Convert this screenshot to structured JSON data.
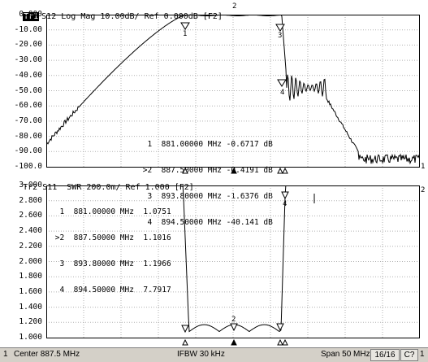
{
  "trace1": {
    "badge": "Tr1",
    "header": "S12 Log Mag 10.00dB/ Ref 0.000dB [F2]",
    "y_labels": [
      "0.000",
      "-10.00",
      "-20.00",
      "-30.00",
      "-40.00",
      "-50.00",
      "-60.00",
      "-70.00",
      "-80.00",
      "-90.00",
      "-100.0"
    ],
    "right_marker": "1",
    "markers": [
      {
        "id": "1",
        "label": "1"
      },
      {
        "id": "2",
        "label": "2"
      },
      {
        "id": "3",
        "label": "3"
      },
      {
        "id": "4",
        "label": "4"
      }
    ],
    "table": [
      "  1  881.00000 MHz -0.6717 dB",
      " >2  887.50000 MHz -0.4191 dB",
      "  3  893.80000 MHz -1.6376 dB",
      "  4  894.50000 MHz -40.141 dB"
    ]
  },
  "trace2": {
    "badge": "Tr2",
    "header": "S11  SWR 200.0m/ Ref 1.000 [F2]",
    "y_labels": [
      "3.000",
      "2.800",
      "2.600",
      "2.400",
      "2.200",
      "2.000",
      "1.800",
      "1.600",
      "1.400",
      "1.200",
      "1.000"
    ],
    "right_marker": "2",
    "markers": [
      {
        "id": "2",
        "label": "2"
      },
      {
        "id": "4",
        "label": "4"
      }
    ],
    "table": [
      "  1  881.00000 MHz  1.0751",
      " >2  887.50000 MHz  1.1016",
      "  3  893.80000 MHz  1.1966",
      "  4  894.50000 MHz  7.7917"
    ]
  },
  "status_bar": {
    "channel": "1",
    "center": "Center 887.5 MHz",
    "ifbw": "IFBW 30 kHz",
    "span": "Span 50 MHz",
    "sweep_count": "16/16",
    "cal": "C?",
    "end": "1"
  },
  "colors": {
    "trace": "#000000",
    "grid": "#b0b0b0",
    "background": "#ffffff",
    "statusbar": "#d4d0c8"
  }
}
